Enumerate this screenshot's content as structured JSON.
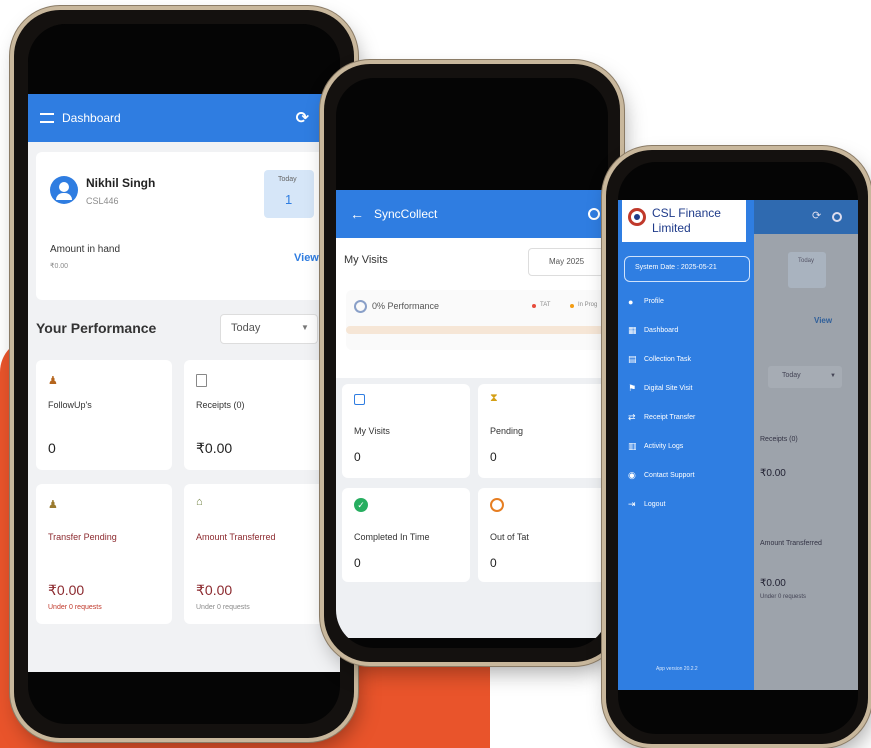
{
  "phone1": {
    "title": "Dashboard",
    "user_name": "Nikhil Singh",
    "user_code": "CSL446",
    "today_label": "Today",
    "today_value": "1",
    "amount_label": "Amount in hand",
    "amount_value": "₹0.00",
    "view_link": "View",
    "performance_title": "Your Performance",
    "period_select": "Today",
    "followups_label": "FollowUp's",
    "followups_value": "0",
    "receipts_label": "Receipts (0)",
    "receipts_value": "₹0.00",
    "transfer_pending_label": "Transfer Pending",
    "transfer_pending_value": "₹0.00",
    "transfer_pending_sub": "Under 0 requests",
    "amount_transferred_label": "Amount Transferred",
    "amount_transferred_value": "₹0.00",
    "amount_transferred_sub": "Under 0 requests"
  },
  "phone2": {
    "title": "SyncCollect",
    "visits_title": "My Visits",
    "month": "May 2025",
    "performance": "0% Performance",
    "legend_1": "TAT",
    "legend_2": "In Prog",
    "my_visits_label": "My Visits",
    "my_visits_value": "0",
    "pending_label": "Pending",
    "pending_value": "0",
    "completed_label": "Completed In Time",
    "completed_value": "0",
    "out_label": "Out of Tat",
    "out_value": "0"
  },
  "phone3": {
    "logo_line1": "CSL Finance",
    "logo_line2": "Limited",
    "system_date": "System Date : 2025-05-21",
    "menu": [
      "Profile",
      "Dashboard",
      "Collection Task",
      "Digital Site Visit",
      "Receipt Transfer",
      "Activity Logs",
      "Contact Support",
      "Logout"
    ],
    "app_version": "App version 20.2.2",
    "bg_today": "Today",
    "bg_view": "View",
    "bg_period": "Today",
    "bg_receipts": "Receipts (0)",
    "bg_amount1": "₹0.00",
    "bg_transferred": "Amount Transferred",
    "bg_amount2": "₹0.00",
    "bg_sub": "Under 0 requests"
  },
  "colors": {
    "accent": "#2f7de1",
    "orange": "#e9542b",
    "maroon": "#8c2a2f",
    "drawer": "#2f7ee2"
  }
}
